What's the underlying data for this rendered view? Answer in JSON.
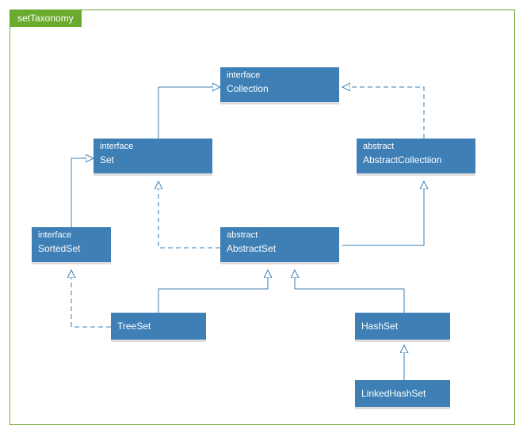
{
  "diagram": {
    "title": "setTaxonomy",
    "nodes": {
      "collection": {
        "stereotype": "interface",
        "name": "Collection"
      },
      "set": {
        "stereotype": "interface",
        "name": "Set"
      },
      "abstractCollection": {
        "stereotype": "abstract",
        "name": "AbstractCollectiion"
      },
      "sortedSet": {
        "stereotype": "interface",
        "name": "SortedSet"
      },
      "abstractSet": {
        "stereotype": "abstract",
        "name": "AbstractSet"
      },
      "treeSet": {
        "stereotype": "",
        "name": "TreeSet"
      },
      "hashSet": {
        "stereotype": "",
        "name": "HashSet"
      },
      "linkedHashSet": {
        "stereotype": "",
        "name": "LinkedHashSet"
      }
    },
    "edges": [
      {
        "from": "set",
        "to": "collection",
        "style": "solid"
      },
      {
        "from": "abstractCollection",
        "to": "collection",
        "style": "dashed"
      },
      {
        "from": "sortedSet",
        "to": "set",
        "style": "solid"
      },
      {
        "from": "abstractSet",
        "to": "set",
        "style": "dashed"
      },
      {
        "from": "abstractSet",
        "to": "abstractCollection",
        "style": "solid"
      },
      {
        "from": "treeSet",
        "to": "abstractSet",
        "style": "solid"
      },
      {
        "from": "hashSet",
        "to": "abstractSet",
        "style": "solid"
      },
      {
        "from": "treeSet",
        "to": "sortedSet",
        "style": "dashed"
      },
      {
        "from": "linkedHashSet",
        "to": "hashSet",
        "style": "solid"
      }
    ]
  }
}
